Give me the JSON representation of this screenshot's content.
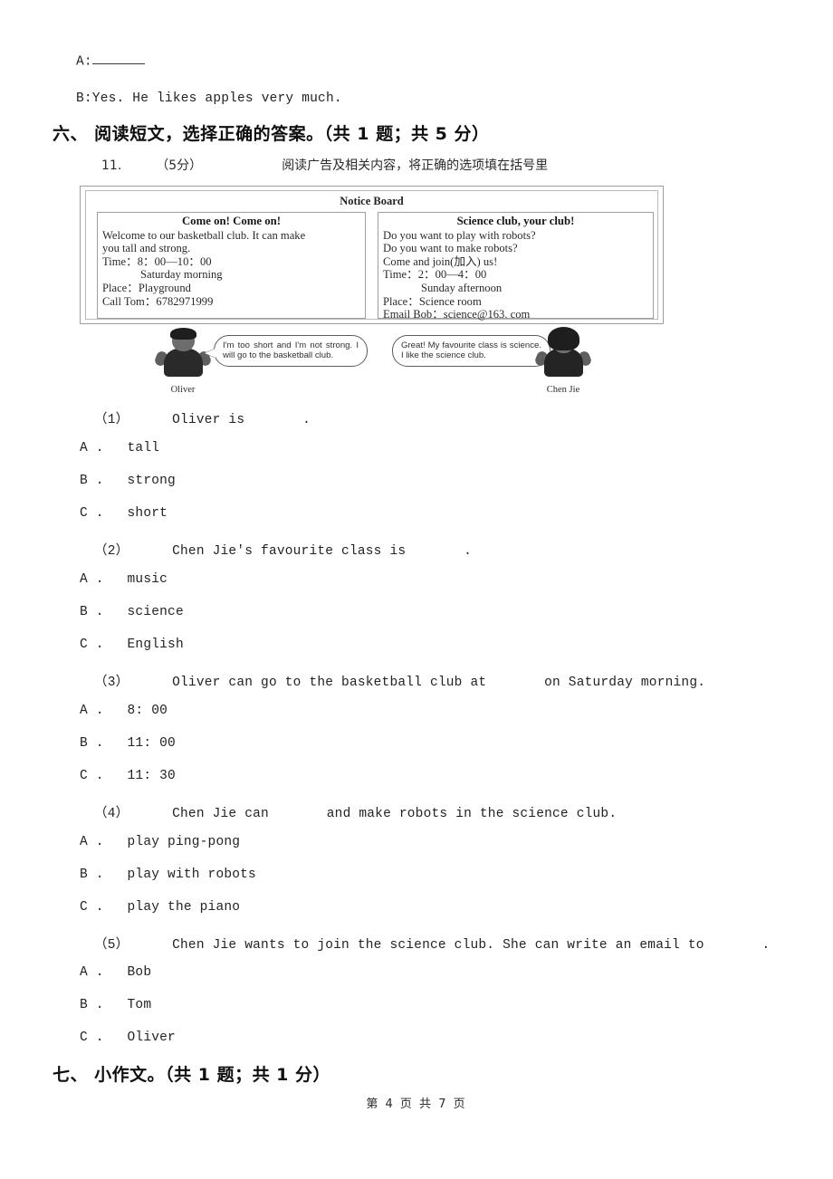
{
  "dialogue": {
    "line_a_label": "A:",
    "line_b": "B:Yes. He likes apples very much."
  },
  "section_six": {
    "heading": "六、 阅读短文，选择正确的答案。（共 1 题；共 5 分）",
    "item_number": "11.",
    "item_points": "（5分）",
    "item_prompt": "阅读广告及相关内容，将正确的选项填在括号里"
  },
  "notice_board": {
    "title": "Notice Board",
    "left_notice": {
      "heading": "Come on! Come on!",
      "lines": [
        "Welcome to our basketball club. It can make",
        "you tall and strong.",
        "Time：8：00—10：00",
        "Saturday morning",
        "Place：Playground",
        "Call Tom：6782971999"
      ]
    },
    "right_notice": {
      "heading": "Science club, your club!",
      "lines": [
        "Do you want to play with robots?",
        "Do you want to make robots?",
        "Come and join(加入) us!",
        "Time：2：00—4：00",
        "Sunday afternoon",
        "Place：Science room",
        "Email Bob：science@163. com"
      ]
    },
    "characters": [
      {
        "name": "Oliver",
        "speech": "I'm too short and I'm not strong. I will go to the basketball club."
      },
      {
        "name": "Chen Jie",
        "speech": "Great! My favourite class is science. I like the science club."
      }
    ]
  },
  "questions": [
    {
      "number": "（1）",
      "stem_before": "Oliver is",
      "stem_after": ".",
      "options": [
        {
          "letter": "A .",
          "text": "tall"
        },
        {
          "letter": "B .",
          "text": "strong"
        },
        {
          "letter": "C .",
          "text": "short"
        }
      ]
    },
    {
      "number": "（2）",
      "stem_before": "Chen Jie's favourite class is",
      "stem_after": ".",
      "options": [
        {
          "letter": "A .",
          "text": "music"
        },
        {
          "letter": "B .",
          "text": "science"
        },
        {
          "letter": "C .",
          "text": "English"
        }
      ]
    },
    {
      "number": "（3）",
      "stem_before": "Oliver can go to the basketball club at",
      "stem_after": "on Saturday morning.",
      "options": [
        {
          "letter": "A .",
          "text": "8: 00"
        },
        {
          "letter": "B .",
          "text": "11: 00"
        },
        {
          "letter": "C .",
          "text": "11: 30"
        }
      ]
    },
    {
      "number": "（4）",
      "stem_before": "Chen Jie can",
      "stem_after": "and make robots in the science club.",
      "options": [
        {
          "letter": "A .",
          "text": "play ping-pong"
        },
        {
          "letter": "B .",
          "text": "play with robots"
        },
        {
          "letter": "C .",
          "text": "play the piano"
        }
      ]
    },
    {
      "number": "（5）",
      "stem_before": "Chen Jie wants to join the science club. She can write an email to",
      "stem_after": ".",
      "options": [
        {
          "letter": "A .",
          "text": "Bob"
        },
        {
          "letter": "B .",
          "text": "Tom"
        },
        {
          "letter": "C .",
          "text": "Oliver"
        }
      ]
    }
  ],
  "section_seven": {
    "heading": "七、 小作文。（共 1 题；共 1 分）"
  },
  "footer": {
    "text": "第 4 页 共 7 页"
  }
}
